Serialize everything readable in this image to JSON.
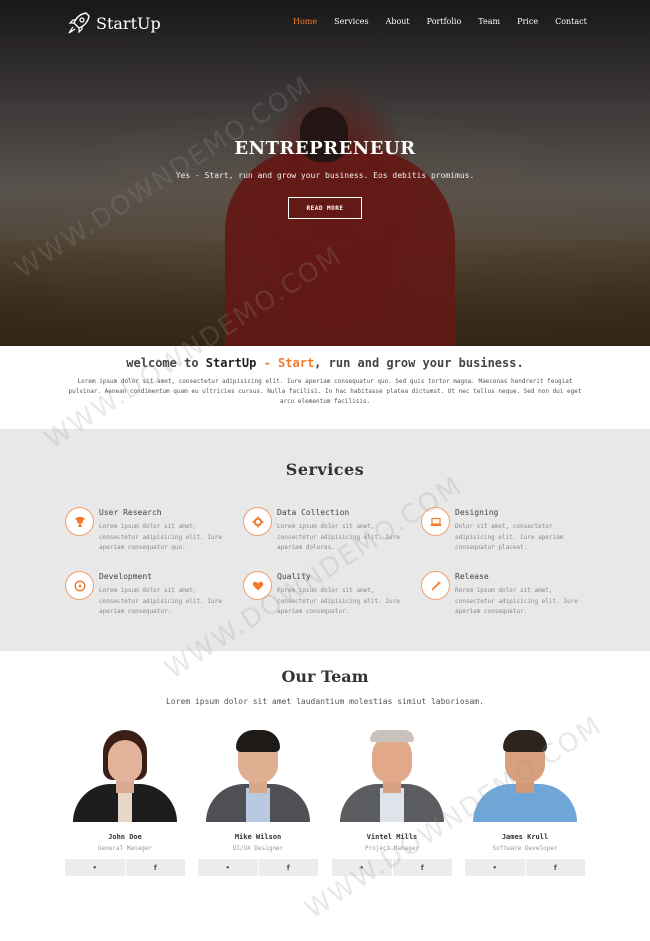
{
  "brand": {
    "name": "StartUp",
    "accent": "#f47a2e"
  },
  "nav": {
    "items": [
      {
        "label": "Home",
        "active": true
      },
      {
        "label": "Services",
        "active": false
      },
      {
        "label": "About",
        "active": false
      },
      {
        "label": "Portfolio",
        "active": false
      },
      {
        "label": "Team",
        "active": false
      },
      {
        "label": "Price",
        "active": false
      },
      {
        "label": "Contact",
        "active": false
      }
    ]
  },
  "hero": {
    "title": "ENTREPRENEUR",
    "subtitle": "Yes - Start, run and grow your business. Eos debitis promimus.",
    "button": "READ MORE"
  },
  "welcome": {
    "prefix": "welcome to ",
    "brand": "StartUp",
    "dash": " - ",
    "highlight": "Start",
    "suffix": ", run and grow your business.",
    "text": "Lorem ipsum dolor sit amet, consectetur adipisicing elit. Iure aperiam consequatur quo. Sed quis tortor magna. Maecenas hendrerit feugiat pulvinar. Aenean condimentum quam eu ultricies cursus. Nulla facilisi. In hac habitasse platea dictumst. Ut nec tellus neque. Sed non dui eget arcu elementum facilisis."
  },
  "services": {
    "title": "Services",
    "items": [
      {
        "icon": "trophy-icon",
        "title": "User Research",
        "desc": "Lorem ipsum dolor sit amet, consectetur adipisicing elit. Iure aperiam consequatur quo."
      },
      {
        "icon": "gear-icon",
        "title": "Data Collection",
        "desc": "Lorem ipsum dolor sit amet, consectetur adipisicing elit. Iure aperiam dolores."
      },
      {
        "icon": "laptop-icon",
        "title": "Designing",
        "desc": "Dolor sit amet, consectetur adipisicing elit. Iure aperiam consequatur placeat."
      },
      {
        "icon": "clock-icon",
        "title": "Development",
        "desc": "Lorem ipsum dolor sit amet, consectetur adipisicing elit. Iure aperiam consequatur."
      },
      {
        "icon": "heart-icon",
        "title": "Quality",
        "desc": "Forem ipsum dolor sit amet, consectetur adipisicing elit. Iure aperiam consequatur."
      },
      {
        "icon": "wand-icon",
        "title": "Release",
        "desc": "Rorem ipsum dolor sit amet, consectetur adipisicing elit. Iure aperiam consequatur."
      }
    ]
  },
  "team": {
    "title": "Our Team",
    "subtitle": "Lorem ipsum dolor sit amet laudantium molestias simiut laboriosam.",
    "members": [
      {
        "name": "John Doe",
        "role": "General Manager"
      },
      {
        "name": "Mike Wilson",
        "role": "UI/UX Designer"
      },
      {
        "name": "Vintel Mills",
        "role": "Project Manager"
      },
      {
        "name": "James Krull",
        "role": "Software Developer"
      }
    ],
    "social": {
      "twitter": "•",
      "facebook": "f"
    }
  },
  "watermark": "WWW.DOWNDEMO.COM"
}
